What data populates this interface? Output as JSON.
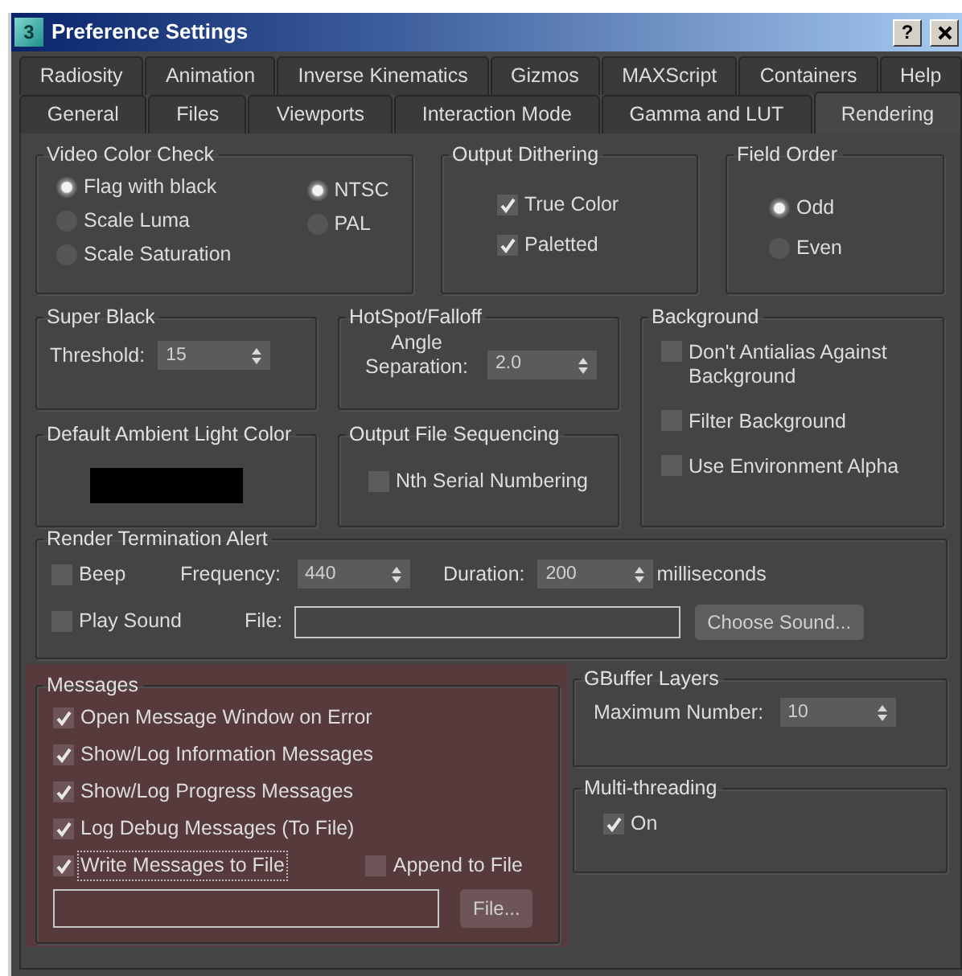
{
  "window": {
    "icon_label": "3",
    "title": "Preference Settings",
    "help_button": "?"
  },
  "tab_rows": [
    {
      "tabs": [
        {
          "label": "Radiosity",
          "selected": false
        },
        {
          "label": "Animation",
          "selected": false
        },
        {
          "label": "Inverse Kinematics",
          "selected": false
        },
        {
          "label": "Gizmos",
          "selected": false
        },
        {
          "label": "MAXScript",
          "selected": false
        },
        {
          "label": "Containers",
          "selected": false
        },
        {
          "label": "Help",
          "selected": false
        }
      ]
    },
    {
      "tabs": [
        {
          "label": "General",
          "selected": false
        },
        {
          "label": "Files",
          "selected": false
        },
        {
          "label": "Viewports",
          "selected": false
        },
        {
          "label": "Interaction Mode",
          "selected": false
        },
        {
          "label": "Gamma and LUT",
          "selected": false
        },
        {
          "label": "Rendering",
          "selected": true
        }
      ]
    }
  ],
  "video_color_check": {
    "title": "Video Color Check",
    "modes": [
      {
        "label": "Flag with black",
        "selected": true
      },
      {
        "label": "Scale Luma",
        "selected": false
      },
      {
        "label": "Scale Saturation",
        "selected": false
      }
    ],
    "standards": [
      {
        "label": "NTSC",
        "selected": true
      },
      {
        "label": "PAL",
        "selected": false
      }
    ]
  },
  "output_dithering": {
    "title": "Output Dithering",
    "options": [
      {
        "label": "True Color",
        "checked": true
      },
      {
        "label": "Paletted",
        "checked": true
      }
    ]
  },
  "field_order": {
    "title": "Field Order",
    "options": [
      {
        "label": "Odd",
        "selected": true
      },
      {
        "label": "Even",
        "selected": false
      }
    ]
  },
  "super_black": {
    "title": "Super Black",
    "threshold_label": "Threshold:",
    "threshold": "15"
  },
  "hotspot_falloff": {
    "title": "HotSpot/Falloff",
    "angle_label": "Angle Separation:",
    "angle": "2.0"
  },
  "background": {
    "title": "Background",
    "options": [
      {
        "label": "Don't Antialias Against Background",
        "checked": false
      },
      {
        "label": "Filter Background",
        "checked": false
      },
      {
        "label": "Use Environment Alpha",
        "checked": false
      }
    ]
  },
  "default_ambient_light_color": {
    "title": "Default Ambient Light Color"
  },
  "output_file_sequencing": {
    "title": "Output File Sequencing",
    "options": [
      {
        "label": "Nth Serial Numbering",
        "checked": false
      }
    ]
  },
  "render_termination_alert": {
    "title": "Render Termination Alert",
    "beep": {
      "label": "Beep",
      "checked": false
    },
    "frequency_label": "Frequency:",
    "frequency": "440",
    "duration_label": "Duration:",
    "duration": "200",
    "duration_unit": "milliseconds",
    "play_sound": {
      "label": "Play Sound",
      "checked": false
    },
    "file_label": "File:",
    "choose_button": "Choose Sound..."
  },
  "messages": {
    "title": "Messages",
    "highlighted": true,
    "options": [
      {
        "label": "Open Message Window on Error",
        "checked": true,
        "focused": false
      },
      {
        "label": "Show/Log Information Messages",
        "checked": true,
        "focused": false
      },
      {
        "label": "Show/Log Progress Messages",
        "checked": true,
        "focused": false
      },
      {
        "label": "Log Debug Messages (To File)",
        "checked": true,
        "focused": false
      },
      {
        "label": "Write Messages to File",
        "checked": true,
        "focused": true
      }
    ],
    "append": {
      "label": "Append to File",
      "checked": false
    },
    "file_button": "File..."
  },
  "gbuffer_layers": {
    "title": "GBuffer Layers",
    "max_label": "Maximum Number:",
    "max_value": "10"
  },
  "multithreading": {
    "title": "Multi-threading",
    "options": [
      {
        "label": "On",
        "checked": true
      }
    ]
  }
}
